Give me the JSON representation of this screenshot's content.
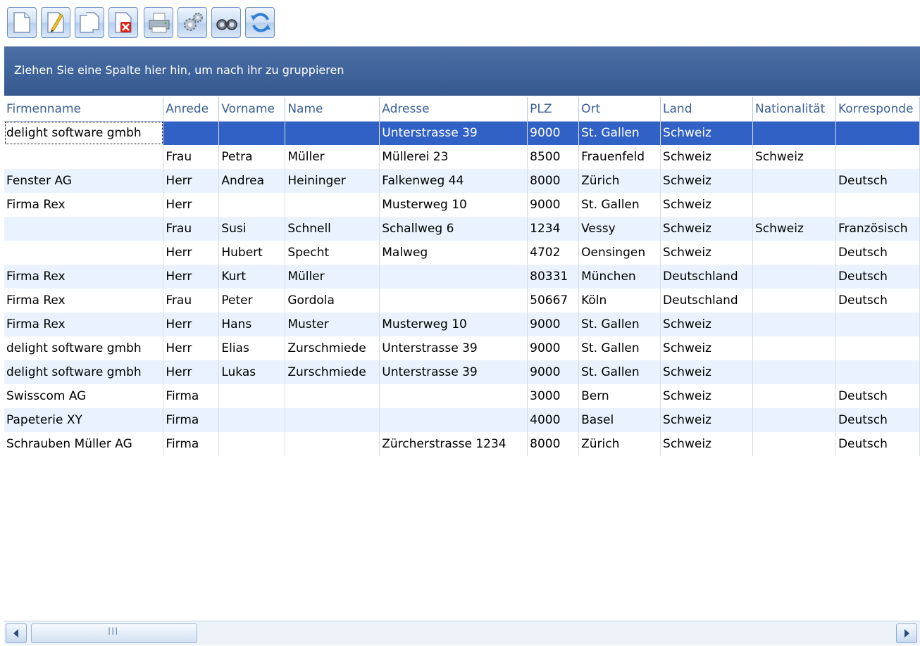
{
  "toolbar": {
    "buttons": [
      {
        "name": "new-document-icon"
      },
      {
        "name": "edit-document-icon"
      },
      {
        "name": "copy-document-icon"
      },
      {
        "name": "delete-document-icon"
      },
      {
        "name": "printer-icon"
      },
      {
        "name": "settings-gears-icon"
      },
      {
        "name": "binoculars-search-icon"
      },
      {
        "name": "refresh-icon"
      }
    ]
  },
  "group_panel": {
    "text": "Ziehen Sie eine Spalte hier hin, um nach ihr zu gruppieren"
  },
  "grid": {
    "columns": [
      "Firmenname",
      "Anrede",
      "Vorname",
      "Name",
      "Adresse",
      "PLZ",
      "Ort",
      "Land",
      "Nationalität",
      "Korresponde"
    ],
    "rows": [
      [
        "delight software gmbh",
        "",
        "",
        "",
        "Unterstrasse 39",
        "9000",
        "St. Gallen",
        "Schweiz",
        "",
        ""
      ],
      [
        "",
        "Frau",
        "Petra",
        "Müller",
        "Müllerei 23",
        "8500",
        "Frauenfeld",
        "Schweiz",
        "Schweiz",
        ""
      ],
      [
        "Fenster AG",
        "Herr",
        "Andrea",
        "Heininger",
        "Falkenweg 44",
        "8000",
        "Zürich",
        "Schweiz",
        "",
        "Deutsch"
      ],
      [
        "Firma Rex",
        "Herr",
        "",
        "",
        "Musterweg 10",
        "9000",
        "St. Gallen",
        "Schweiz",
        "",
        ""
      ],
      [
        "",
        "Frau",
        "Susi",
        "Schnell",
        "Schallweg 6",
        "1234",
        "Vessy",
        "Schweiz",
        "Schweiz",
        "Französisch"
      ],
      [
        "",
        "Herr",
        "Hubert",
        "Specht",
        "Malweg",
        "4702",
        "Oensingen",
        "Schweiz",
        "",
        "Deutsch"
      ],
      [
        "Firma Rex",
        "Herr",
        "Kurt",
        "Müller",
        "",
        "80331",
        "München",
        "Deutschland",
        "",
        "Deutsch"
      ],
      [
        "Firma Rex",
        "Frau",
        "Peter",
        "Gordola",
        "",
        "50667",
        "Köln",
        "Deutschland",
        "",
        "Deutsch"
      ],
      [
        "Firma Rex",
        "Herr",
        "Hans",
        "Muster",
        "Musterweg 10",
        "9000",
        "St. Gallen",
        "Schweiz",
        "",
        ""
      ],
      [
        "delight software gmbh",
        "Herr",
        "Elias",
        "Zurschmiede",
        "Unterstrasse 39",
        "9000",
        "St. Gallen",
        "Schweiz",
        "",
        ""
      ],
      [
        "delight software gmbh",
        "Herr",
        "Lukas",
        "Zurschmiede",
        "Unterstrasse 39",
        "9000",
        "St. Gallen",
        "Schweiz",
        "",
        ""
      ],
      [
        "Swisscom AG",
        "Firma",
        "",
        "",
        "",
        "3000",
        "Bern",
        "Schweiz",
        "",
        "Deutsch"
      ],
      [
        "Papeterie XY",
        "Firma",
        "",
        "",
        "",
        "4000",
        "Basel",
        "Schweiz",
        "",
        "Deutsch"
      ],
      [
        "Schrauben Müller AG",
        "Firma",
        "",
        "",
        "Zürcherstrasse 1234",
        "8000",
        "Zürich",
        "Schweiz",
        "",
        "Deutsch"
      ]
    ]
  },
  "scrollbar": {
    "thumb_grip": "III",
    "left_arrow": "scroll-left-arrow-icon",
    "right_arrow": "scroll-right-arrow-icon"
  },
  "colors": {
    "group_panel": "#3f649b",
    "selected_row": "#3161c5",
    "header_text": "#3b5f95",
    "alt_row": "#eaf3fd"
  }
}
